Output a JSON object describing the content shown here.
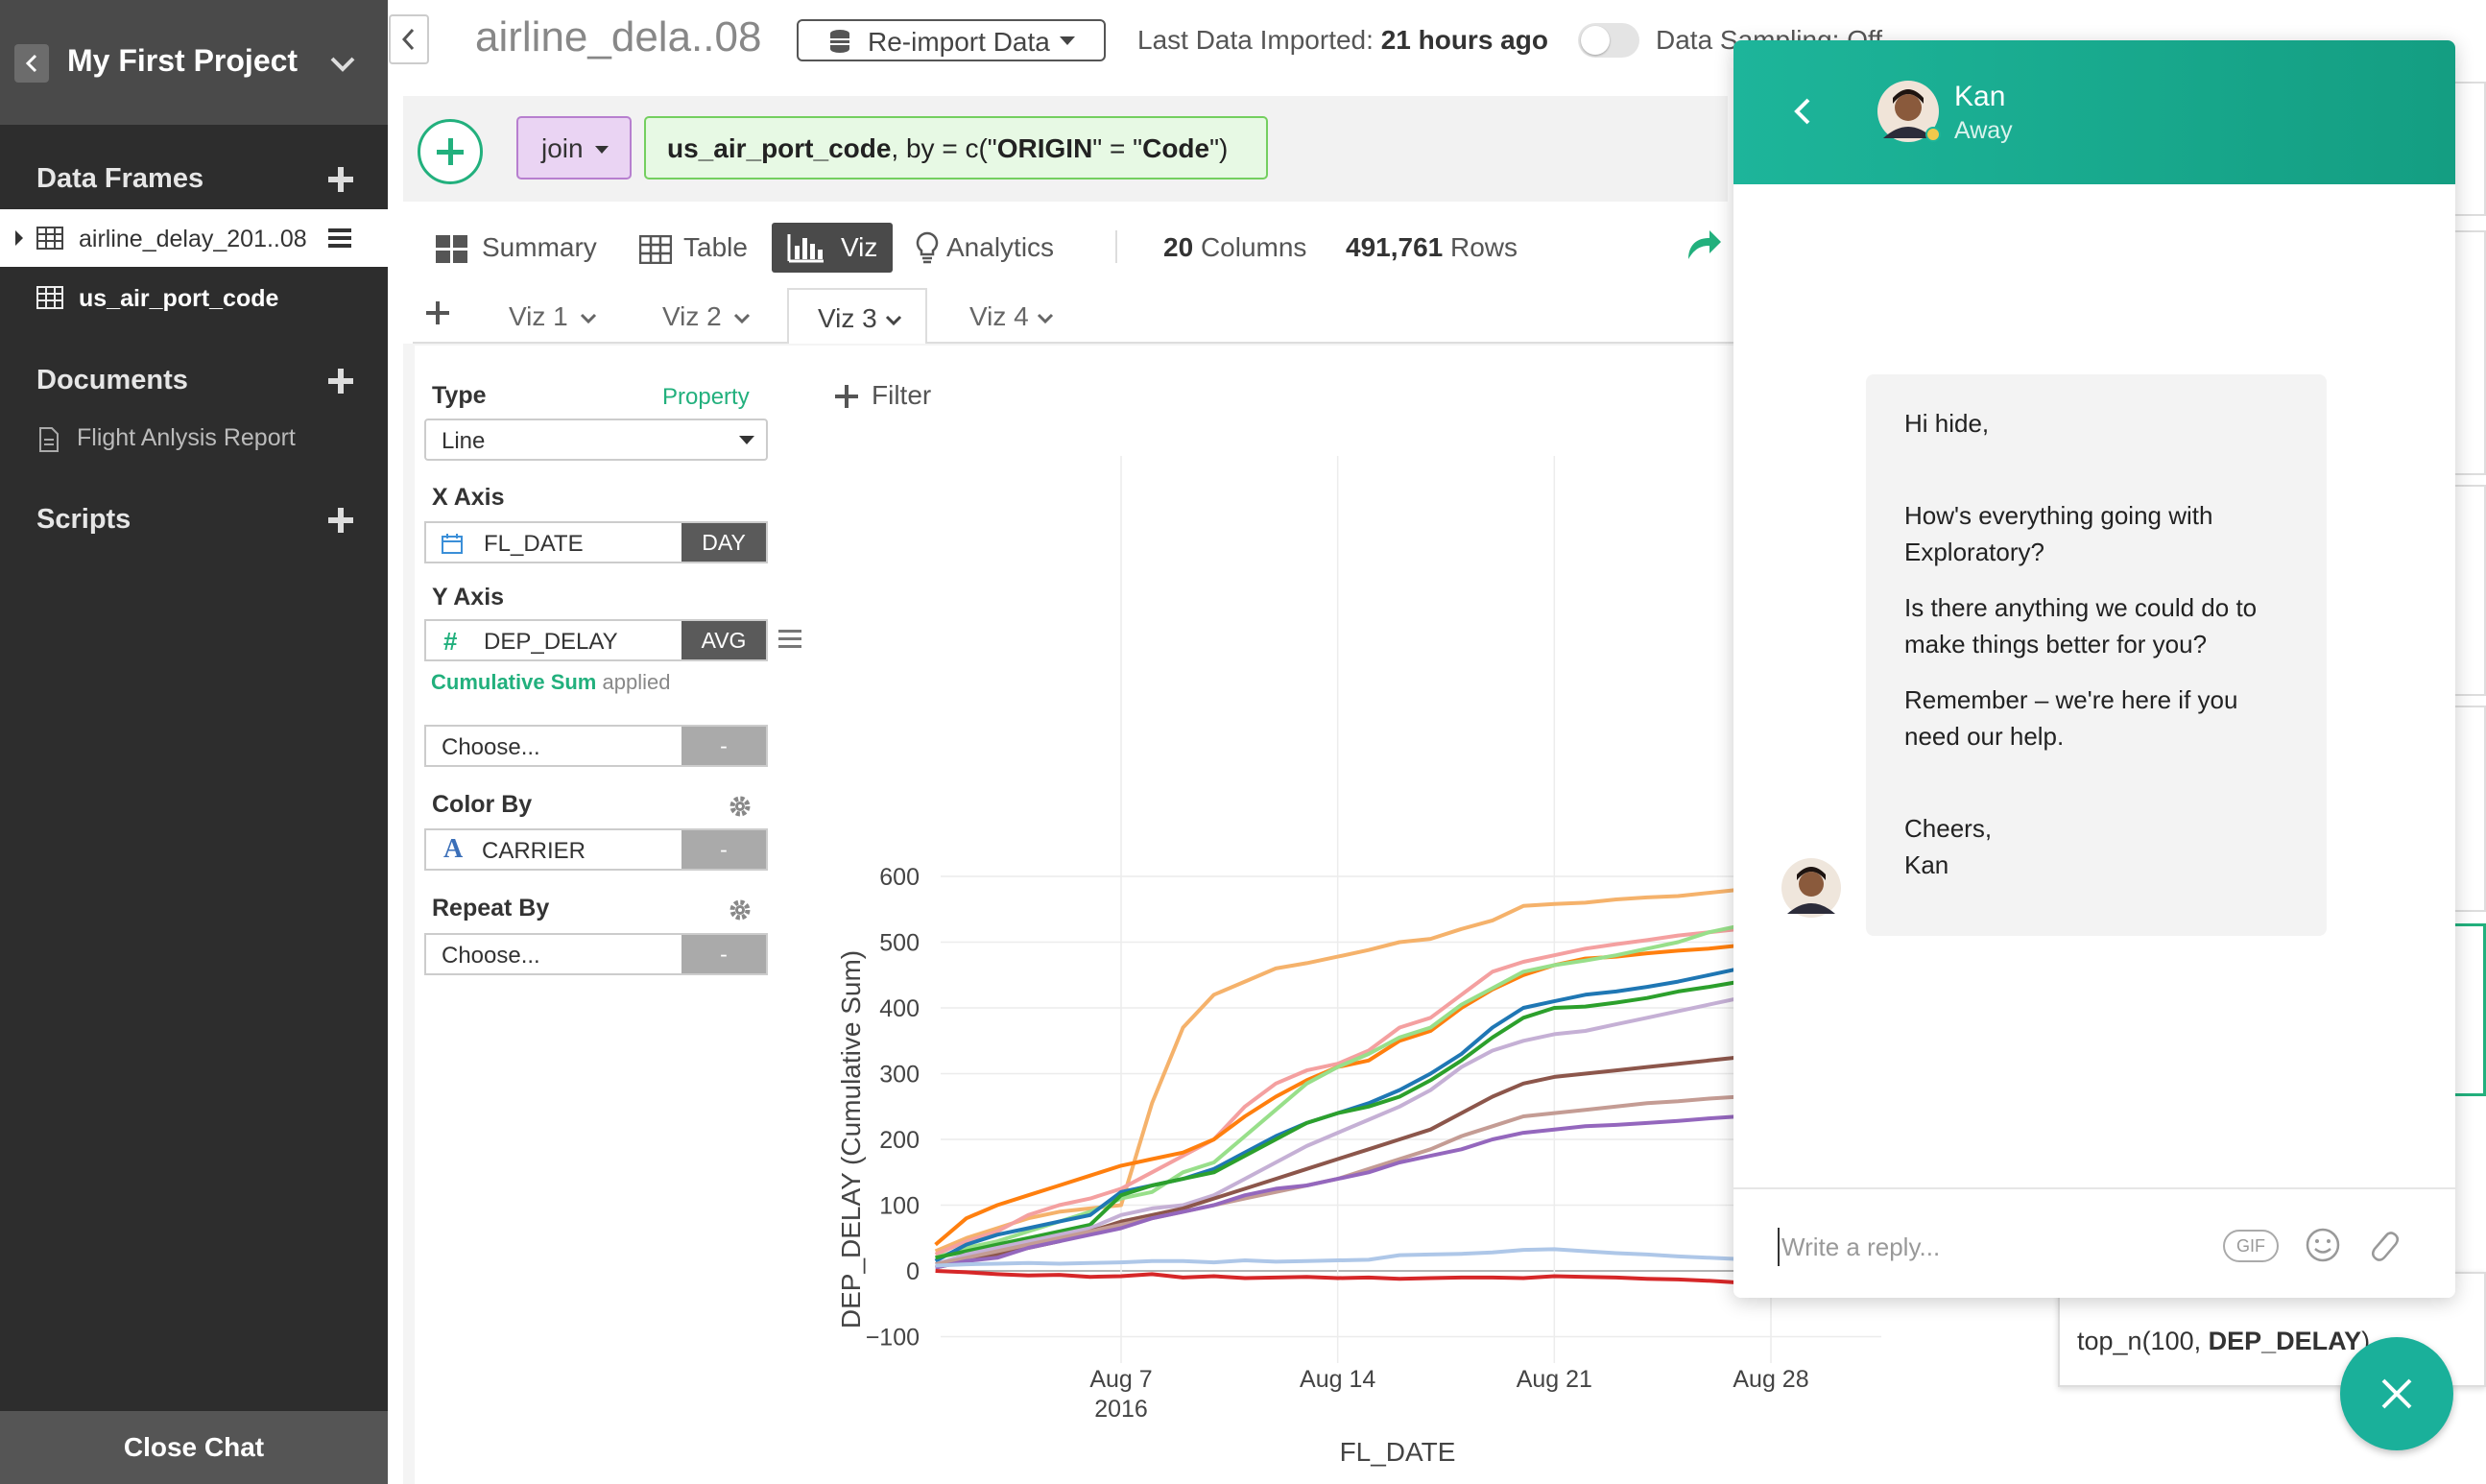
{
  "project": {
    "title": "My First Project"
  },
  "sidebar": {
    "sections": {
      "data_frames": "Data Frames",
      "documents": "Documents",
      "scripts": "Scripts"
    },
    "data_frames": [
      "airline_delay_201..08",
      "us_air_port_code"
    ],
    "documents": [
      "Flight Anlysis Report"
    ],
    "close_chat": "Close Chat"
  },
  "topbar": {
    "df_title": "airline_dela..08",
    "reimport": "Re-import Data",
    "last_imported_label": "Last Data Imported:",
    "last_imported_value": "21 hours ago",
    "sampling": "Data Sampling: Off"
  },
  "step": {
    "command": "join",
    "expr_target": "us_air_port_code",
    "expr_mid": ", by = c(\"",
    "expr_key1": "ORIGIN",
    "expr_eq": "\" = \"",
    "expr_key2": "Code",
    "expr_end": "\")"
  },
  "view_tabs": [
    "Summary",
    "Table",
    "Viz",
    "Analytics"
  ],
  "stats": {
    "columns": "20",
    "columns_label": "Columns",
    "rows": "491,761",
    "rows_label": "Rows"
  },
  "viz_tabs": [
    "Viz 1",
    "Viz 2",
    "Viz 3",
    "Viz 4"
  ],
  "panel": {
    "type_label": "Type",
    "property_link": "Property",
    "type_value": "Line",
    "x_label": "X Axis",
    "x_field": "FL_DATE",
    "x_agg": "DAY",
    "y_label": "Y Axis",
    "y_field": "DEP_DELAY",
    "y_agg": "AVG",
    "cumsum_bold": "Cumulative Sum",
    "cumsum_rest": "applied",
    "choose": "Choose...",
    "dash": "-",
    "color_label": "Color By",
    "color_field": "CARRIER",
    "repeat_label": "Repeat By",
    "filter": "Filter"
  },
  "chart_data": {
    "type": "line",
    "xlabel": "FL_DATE",
    "ylabel": "DEP_DELAY (Cumulative Sum)",
    "x_ticks": [
      "Aug 7",
      "Aug 14",
      "Aug 21",
      "Aug 28"
    ],
    "x_tick_sub": "2016",
    "y_ticks": [
      -100,
      0,
      100,
      200,
      300,
      400,
      500,
      600
    ],
    "ylim": [
      -130,
      700
    ],
    "x": [
      "2016-08-01",
      "2016-08-02",
      "2016-08-03",
      "2016-08-04",
      "2016-08-05",
      "2016-08-06",
      "2016-08-07",
      "2016-08-08",
      "2016-08-09",
      "2016-08-10",
      "2016-08-11",
      "2016-08-12",
      "2016-08-13",
      "2016-08-14",
      "2016-08-15",
      "2016-08-16",
      "2016-08-17",
      "2016-08-18",
      "2016-08-19",
      "2016-08-20",
      "2016-08-21",
      "2016-08-22",
      "2016-08-23",
      "2016-08-24",
      "2016-08-25",
      "2016-08-26",
      "2016-08-27",
      "2016-08-28"
    ],
    "series": [
      {
        "color": "#f5b26b",
        "values": [
          30,
          50,
          65,
          80,
          90,
          95,
          100,
          255,
          370,
          420,
          440,
          460,
          468,
          478,
          488,
          500,
          505,
          520,
          533,
          555,
          558,
          560,
          565,
          568,
          570,
          575,
          580,
          585
        ]
      },
      {
        "color": "#f4a0a0",
        "values": [
          25,
          45,
          60,
          85,
          100,
          110,
          125,
          150,
          175,
          200,
          250,
          285,
          305,
          315,
          335,
          370,
          385,
          420,
          455,
          470,
          480,
          490,
          497,
          503,
          510,
          515,
          520,
          528
        ]
      },
      {
        "color": "#ff7f0e",
        "values": [
          40,
          80,
          100,
          115,
          130,
          145,
          160,
          170,
          180,
          200,
          235,
          265,
          290,
          310,
          320,
          350,
          365,
          400,
          428,
          450,
          465,
          475,
          478,
          483,
          487,
          490,
          495,
          500
        ]
      },
      {
        "color": "#98df8a",
        "values": [
          20,
          35,
          45,
          60,
          75,
          90,
          110,
          120,
          150,
          165,
          205,
          245,
          285,
          310,
          330,
          355,
          370,
          405,
          430,
          455,
          465,
          472,
          480,
          490,
          500,
          515,
          525,
          535
        ]
      },
      {
        "color": "#1f77b4",
        "values": [
          15,
          40,
          55,
          65,
          75,
          85,
          120,
          130,
          140,
          155,
          180,
          205,
          225,
          240,
          255,
          275,
          300,
          330,
          370,
          400,
          410,
          420,
          425,
          432,
          440,
          450,
          460,
          470
        ]
      },
      {
        "color": "#2ca02c",
        "values": [
          20,
          30,
          40,
          50,
          60,
          70,
          115,
          130,
          140,
          150,
          175,
          200,
          225,
          240,
          250,
          265,
          290,
          320,
          355,
          385,
          400,
          402,
          408,
          415,
          425,
          432,
          440,
          450
        ]
      },
      {
        "color": "#c5b0d5",
        "values": [
          10,
          25,
          35,
          45,
          55,
          65,
          85,
          95,
          100,
          115,
          140,
          165,
          190,
          210,
          230,
          250,
          275,
          310,
          335,
          350,
          360,
          365,
          375,
          385,
          395,
          405,
          415,
          425
        ]
      },
      {
        "color": "#8c564b",
        "values": [
          5,
          15,
          25,
          35,
          45,
          60,
          75,
          85,
          95,
          110,
          125,
          140,
          155,
          170,
          185,
          200,
          215,
          240,
          265,
          285,
          295,
          300,
          305,
          310,
          315,
          320,
          325,
          330
        ]
      },
      {
        "color": "#c49c94",
        "values": [
          10,
          20,
          30,
          40,
          50,
          60,
          70,
          80,
          90,
          100,
          110,
          120,
          130,
          140,
          155,
          170,
          185,
          205,
          220,
          235,
          240,
          245,
          250,
          255,
          258,
          262,
          265,
          270
        ]
      },
      {
        "color": "#9467bd",
        "values": [
          5,
          15,
          20,
          35,
          45,
          55,
          65,
          80,
          90,
          100,
          115,
          125,
          130,
          140,
          150,
          165,
          175,
          185,
          200,
          210,
          215,
          220,
          222,
          225,
          228,
          232,
          235,
          240
        ]
      },
      {
        "color": "#aec7e8",
        "values": [
          8,
          10,
          11,
          12,
          11,
          12,
          13,
          15,
          15,
          13,
          16,
          14,
          15,
          16,
          17,
          24,
          25,
          26,
          28,
          32,
          33,
          30,
          27,
          25,
          22,
          20,
          18,
          16
        ]
      },
      {
        "color": "#d62728",
        "values": [
          0,
          -2,
          -5,
          -7,
          -6,
          -9,
          -8,
          -5,
          -10,
          -8,
          -11,
          -10,
          -9,
          -11,
          -10,
          -12,
          -11,
          -10,
          -10,
          -11,
          -8,
          -9,
          -10,
          -12,
          -13,
          -15,
          -18,
          -20
        ]
      }
    ]
  },
  "bottom_card": {
    "text_a": "top_n(100, ",
    "text_b": "DEP_DELAY",
    "text_c": ")"
  },
  "chat": {
    "name": "Kan",
    "status": "Away",
    "messages": [
      "Hi hide,",
      "How's everything going with",
      "Exploratory?",
      "Is there anything we could do to",
      "make things better for you?",
      "Remember – we're here if you",
      "need our help.",
      "Cheers,",
      "Kan"
    ],
    "reply_placeholder": "Write a reply...",
    "gif": "GIF"
  },
  "colors": {
    "accent_green": "#22b07d",
    "chat_teal": "#1ab09a",
    "sidebar_dark": "#2d2d2d"
  },
  "icons": [
    "chevron-left-icon",
    "chevron-down-icon",
    "plus-icon",
    "table-icon",
    "menu-icon",
    "document-icon",
    "database-icon",
    "calendar-icon",
    "hash-icon",
    "font-icon",
    "gear-icon",
    "summary-icon",
    "bar-chart-icon",
    "lightbulb-icon",
    "share-arrow-icon",
    "filter-plus-icon",
    "emoji-icon",
    "paperclip-icon",
    "close-icon"
  ]
}
